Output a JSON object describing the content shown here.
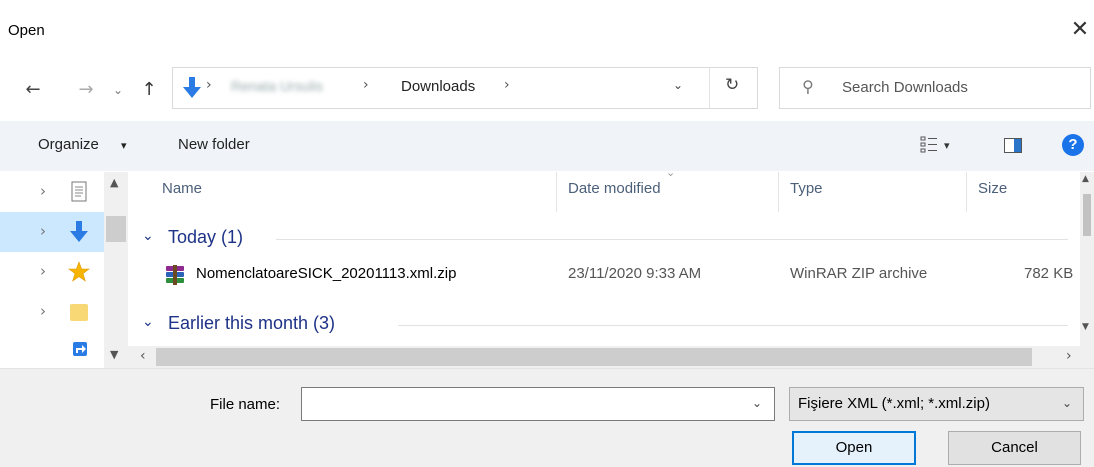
{
  "window": {
    "title": "Open",
    "close_glyph": "✕"
  },
  "nav_buttons": {
    "back": "←",
    "forward": "→",
    "recent": "⌄",
    "up": "↑"
  },
  "address": {
    "separator": "›",
    "user_folder": "Renata Ursulis",
    "current_folder": "Downloads",
    "dropdown_glyph": "⌄",
    "refresh_glyph": "↻"
  },
  "search": {
    "placeholder": "Search Downloads",
    "icon": "search-icon"
  },
  "toolbar": {
    "organize_label": "Organize",
    "organize_arrow": "▾",
    "new_folder_label": "New folder",
    "view_arrow": "▾",
    "help_glyph": "?"
  },
  "nav_pane": {
    "items": [
      {
        "icon": "document-icon",
        "selected": false
      },
      {
        "icon": "download-icon",
        "selected": true
      },
      {
        "icon": "star-icon",
        "selected": false
      },
      {
        "icon": "folder-icon",
        "selected": false
      },
      {
        "icon": "shortcut-icon",
        "selected": false
      }
    ],
    "chevron": "›",
    "scroll_up": "▲",
    "scroll_down": "▼"
  },
  "columns": {
    "name": "Name",
    "date": "Date modified",
    "type": "Type",
    "size": "Size"
  },
  "groups": [
    {
      "chevron": "⌄",
      "label": "Today (1)"
    },
    {
      "chevron": "⌄",
      "label": "Earlier this month (3)"
    }
  ],
  "files": [
    {
      "name": "NomenclatoareSICK_20201113.xml.zip",
      "date": "23/11/2020 9:33 AM",
      "type": "WinRAR ZIP archive",
      "size": "782 KB",
      "icon": "winrar-archive-icon"
    }
  ],
  "scrollbars": {
    "left": "‹",
    "right": "›",
    "up": "▲",
    "down": "▼"
  },
  "bottom": {
    "file_name_label": "File name:",
    "file_name_value": "",
    "drop_glyph": "⌄",
    "filter_label": "Fişiere XML (*.xml; *.xml.zip)",
    "open_label": "Open",
    "cancel_label": "Cancel"
  },
  "colors": {
    "accent": "#0078d7",
    "group_text": "#1e3287",
    "selection": "#cce8ff",
    "toolbar_bg": "#f0f4f9"
  }
}
